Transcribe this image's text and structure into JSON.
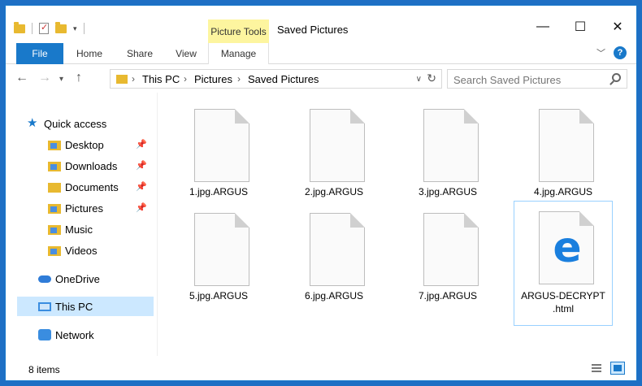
{
  "window": {
    "title": "Saved Pictures",
    "context_tab": "Picture Tools"
  },
  "ribbon": {
    "tabs": [
      "File",
      "Home",
      "Share",
      "View",
      "Manage"
    ]
  },
  "address": {
    "crumbs": [
      "This PC",
      "Pictures",
      "Saved Pictures"
    ],
    "search_placeholder": "Search Saved Pictures"
  },
  "navpane": {
    "quick_access": "Quick access",
    "items": [
      {
        "label": "Desktop",
        "pinned": true
      },
      {
        "label": "Downloads",
        "pinned": true
      },
      {
        "label": "Documents",
        "pinned": true
      },
      {
        "label": "Pictures",
        "pinned": true
      },
      {
        "label": "Music",
        "pinned": false
      },
      {
        "label": "Videos",
        "pinned": false
      }
    ],
    "onedrive": "OneDrive",
    "this_pc": "This PC",
    "network": "Network"
  },
  "files": [
    {
      "name": "1.jpg.ARGUS"
    },
    {
      "name": "2.jpg.ARGUS"
    },
    {
      "name": "3.jpg.ARGUS"
    },
    {
      "name": "4.jpg.ARGUS"
    },
    {
      "name": "5.jpg.ARGUS"
    },
    {
      "name": "6.jpg.ARGUS"
    },
    {
      "name": "7.jpg.ARGUS"
    },
    {
      "name_line1": "ARGUS-DECRYPT",
      "name_line2": ".html",
      "icon": "edge-icon"
    }
  ],
  "status": {
    "item_count": "8 items"
  }
}
